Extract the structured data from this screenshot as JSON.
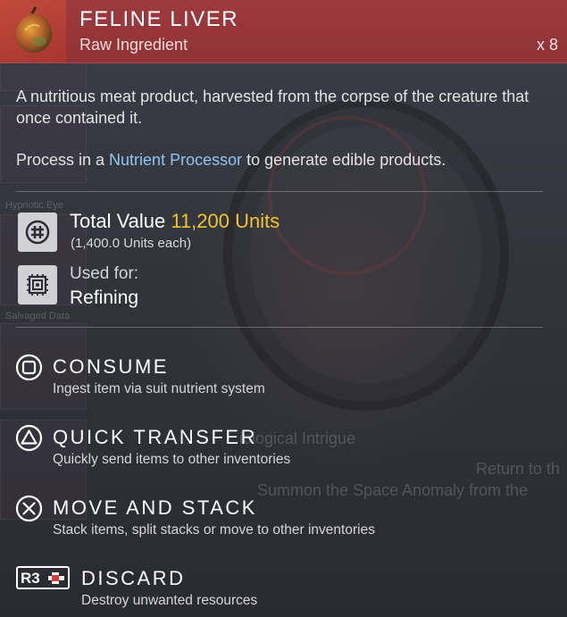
{
  "background": {
    "slot_labels": [
      "Hypnotic Eye",
      "Salvaged Data"
    ],
    "overlay_texts": [
      "iological Intrigue",
      "Return to th",
      "Summon the Space Anomaly from the"
    ]
  },
  "item": {
    "icon": "feline-liver-icon",
    "title": "FELINE LIVER",
    "category": "Raw Ingredient",
    "quantity": "x 8",
    "header_color": "#9a383c"
  },
  "description": {
    "text": "A nutritious meat product, harvested from the corpse of the creature that once contained it.",
    "process_prefix": "Process in a ",
    "process_link": "Nutrient Processor",
    "process_suffix": " to generate edible products."
  },
  "value": {
    "icon": "units-icon",
    "label": "Total Value ",
    "amount": "11,200 Units",
    "each": "(1,400.0 Units each)",
    "accent_color": "#f2c330"
  },
  "usage": {
    "icon": "refiner-icon",
    "label": "Used for:",
    "value": "Refining"
  },
  "actions": [
    {
      "button": "square-button-icon",
      "title": "CONSUME",
      "desc": "Ingest item via suit nutrient system"
    },
    {
      "button": "triangle-button-icon",
      "title": "QUICK TRANSFER",
      "desc": "Quickly send items to other inventories"
    },
    {
      "button": "cross-button-icon",
      "title": "MOVE AND STACK",
      "desc": "Stack items, split stacks or move to other inventories"
    },
    {
      "button": "r3-button-icon",
      "button_label": "R3",
      "title": "DISCARD",
      "desc": "Destroy unwanted resources"
    }
  ]
}
